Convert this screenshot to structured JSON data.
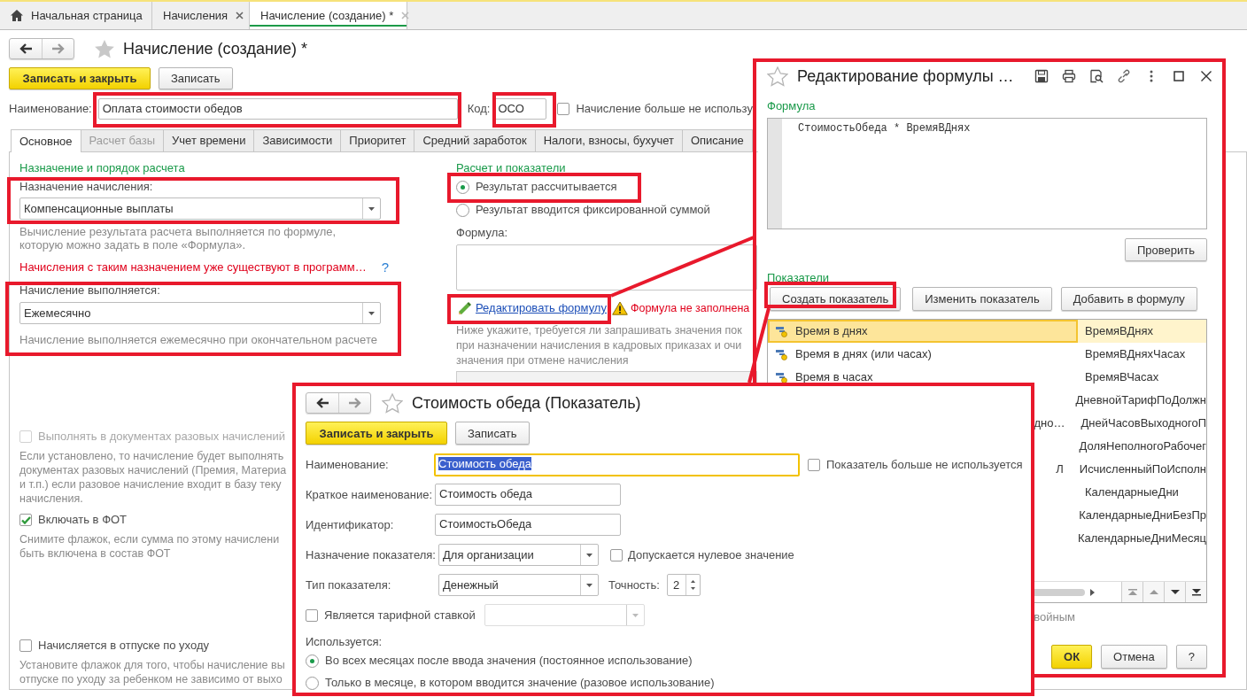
{
  "app_tabs": [
    {
      "kind": "home",
      "label": "Начальная страница",
      "selected": false
    },
    {
      "kind": "closable",
      "label": "Начисления",
      "selected": false
    },
    {
      "kind": "closable",
      "label": "Начисление (создание) *",
      "selected": true
    }
  ],
  "form": {
    "title": "Начисление (создание) *",
    "buttons": [
      {
        "label": "Записать и закрыть",
        "kind": "primary"
      },
      {
        "label": "Записать",
        "kind": "default"
      }
    ],
    "name": {
      "label": "Наименование:",
      "value": "Оплата стоимости обедов"
    },
    "code": {
      "label": "Код:",
      "value": "ОСО"
    },
    "not_used": {
      "label": "Начисление больше не использу",
      "checked": false
    },
    "tabs": [
      {
        "label": "Основное",
        "selected": true,
        "disabled": false
      },
      {
        "label": "Расчет базы",
        "selected": false,
        "disabled": true
      },
      {
        "label": "Учет времени",
        "selected": false,
        "disabled": false
      },
      {
        "label": "Зависимости",
        "selected": false,
        "disabled": false
      },
      {
        "label": "Приоритет",
        "selected": false,
        "disabled": false
      },
      {
        "label": "Средний заработок",
        "selected": false,
        "disabled": false
      },
      {
        "label": "Налоги, взносы, бухучет",
        "selected": false,
        "disabled": false
      },
      {
        "label": "Описание",
        "selected": false,
        "disabled": false
      }
    ],
    "left": {
      "section": "Назначение и порядок расчета",
      "purpose": {
        "label": "Назначение начисления:",
        "value": "Компенсационные выплаты"
      },
      "purpose_hint": "Вычисление результата расчета выполняется по формуле, которую можно задать в поле «Формула».",
      "warning": "Начисления с таким назначением уже существуют в программ…",
      "help": "?",
      "schedule": {
        "label": "Начисление выполняется:",
        "value": "Ежемесячно"
      },
      "schedule_hint": "Начисление выполняется ежемесячно при окончательном расчете",
      "options": [
        {
          "label": "Выполнять в документах разовых начислений",
          "checked": false,
          "disabled": true,
          "hint_lines": [
            "Если установлено, то начисление будет выполнять",
            "документах разовых начислений (Премия, Материа",
            "и т.п.) если разовое начисление входит в базу теку",
            "начисления."
          ]
        },
        {
          "label": "Включать в ФОТ",
          "checked": true,
          "disabled": false,
          "hint_lines": [
            "Снимите флажок, если сумма по этому начислени",
            "быть включена в состав ФОТ"
          ]
        },
        {
          "label": "Начисляется в отпуске по уходу",
          "checked": false,
          "disabled": false,
          "hint_lines": [
            "Установите флажок для того, чтобы начисление вы",
            "отпуске по уходу за ребенком не зависимо от выхо"
          ]
        }
      ]
    },
    "right": {
      "section": "Расчет и показатели",
      "modes": [
        {
          "label": "Результат рассчитывается",
          "selected": true
        },
        {
          "label": "Результат вводится фиксированной суммой",
          "selected": false
        }
      ],
      "formula_label": "Формула:",
      "edit_link": "Редактировать формулу",
      "formula_warning": "Формула не заполнена",
      "hint_lines": [
        "Ниже укажите, требуется ли запрашивать значения пок",
        "при назначении начисления в кадровых приказах и очи",
        "значения при отмене начисления"
      ]
    }
  },
  "formula_window": {
    "title": "Редактирование формулы …",
    "formula_section": "Формула",
    "formula": "СтоимостьОбеда * ВремяВДнях",
    "check_button": "Проверить",
    "indicators_section": "Показатели",
    "actions": [
      "Создать показатель",
      "Изменить показатель",
      "Добавить в формулу"
    ],
    "indicators": [
      {
        "name": "Время в днях",
        "id": "ВремяВДнях",
        "selected": true
      },
      {
        "name": "Время в днях (или часах)",
        "id": "ВремяВДняхЧасах",
        "selected": false
      },
      {
        "name": "Время в часах",
        "id": "ВремяВЧасах",
        "selected": false
      },
      {
        "id": "ДневнойТарифПоДолжн",
        "selected": false
      },
      {
        "name": "дно…",
        "id": "ДнейЧасовВыходногоП",
        "selected": false
      },
      {
        "id": "ДоляНеполногоРабочег",
        "selected": false
      },
      {
        "name": "Л",
        "id": "ИсчисленныйПоИсполн",
        "selected": false
      },
      {
        "id": "КалендарныеДни",
        "selected": false
      },
      {
        "id": "КалендарныеДниБезПр",
        "selected": false
      },
      {
        "id": "КалендарныеДниМесяц",
        "selected": false
      }
    ],
    "hint": "войным",
    "buttons": [
      {
        "label": "ОК",
        "kind": "primary"
      },
      {
        "label": "Отмена",
        "kind": "default"
      },
      {
        "label": "?",
        "kind": "default"
      }
    ]
  },
  "indicator_window": {
    "title": "Стоимость обеда (Показатель)",
    "buttons": [
      {
        "label": "Записать и закрыть",
        "kind": "primary"
      },
      {
        "label": "Записать",
        "kind": "default"
      }
    ],
    "name": {
      "label": "Наименование:",
      "value": "Стоимость обеда",
      "focused": true
    },
    "not_used": {
      "label": "Показатель больше не используется",
      "checked": false
    },
    "short_name": {
      "label": "Краткое наименование:",
      "value": "Стоимость обеда"
    },
    "identifier": {
      "label": "Идентификатор:",
      "value": "СтоимостьОбеда"
    },
    "purpose": {
      "label": "Назначение показателя:",
      "value": "Для организации"
    },
    "zero_allowed": {
      "label": "Допускается нулевое значение",
      "checked": false
    },
    "type": {
      "label": "Тип показателя:",
      "value": "Денежный"
    },
    "precision": {
      "label": "Точность:",
      "value": "2"
    },
    "tariff": {
      "label": "Является тарифной ставкой",
      "checked": false
    },
    "usage_label": "Используется:",
    "usage": [
      {
        "label": "Во всех месяцах после ввода значения (постоянное использование)",
        "selected": true
      },
      {
        "label": "Только в месяце, в котором вводится значение (разовое использование)",
        "selected": false
      }
    ]
  }
}
